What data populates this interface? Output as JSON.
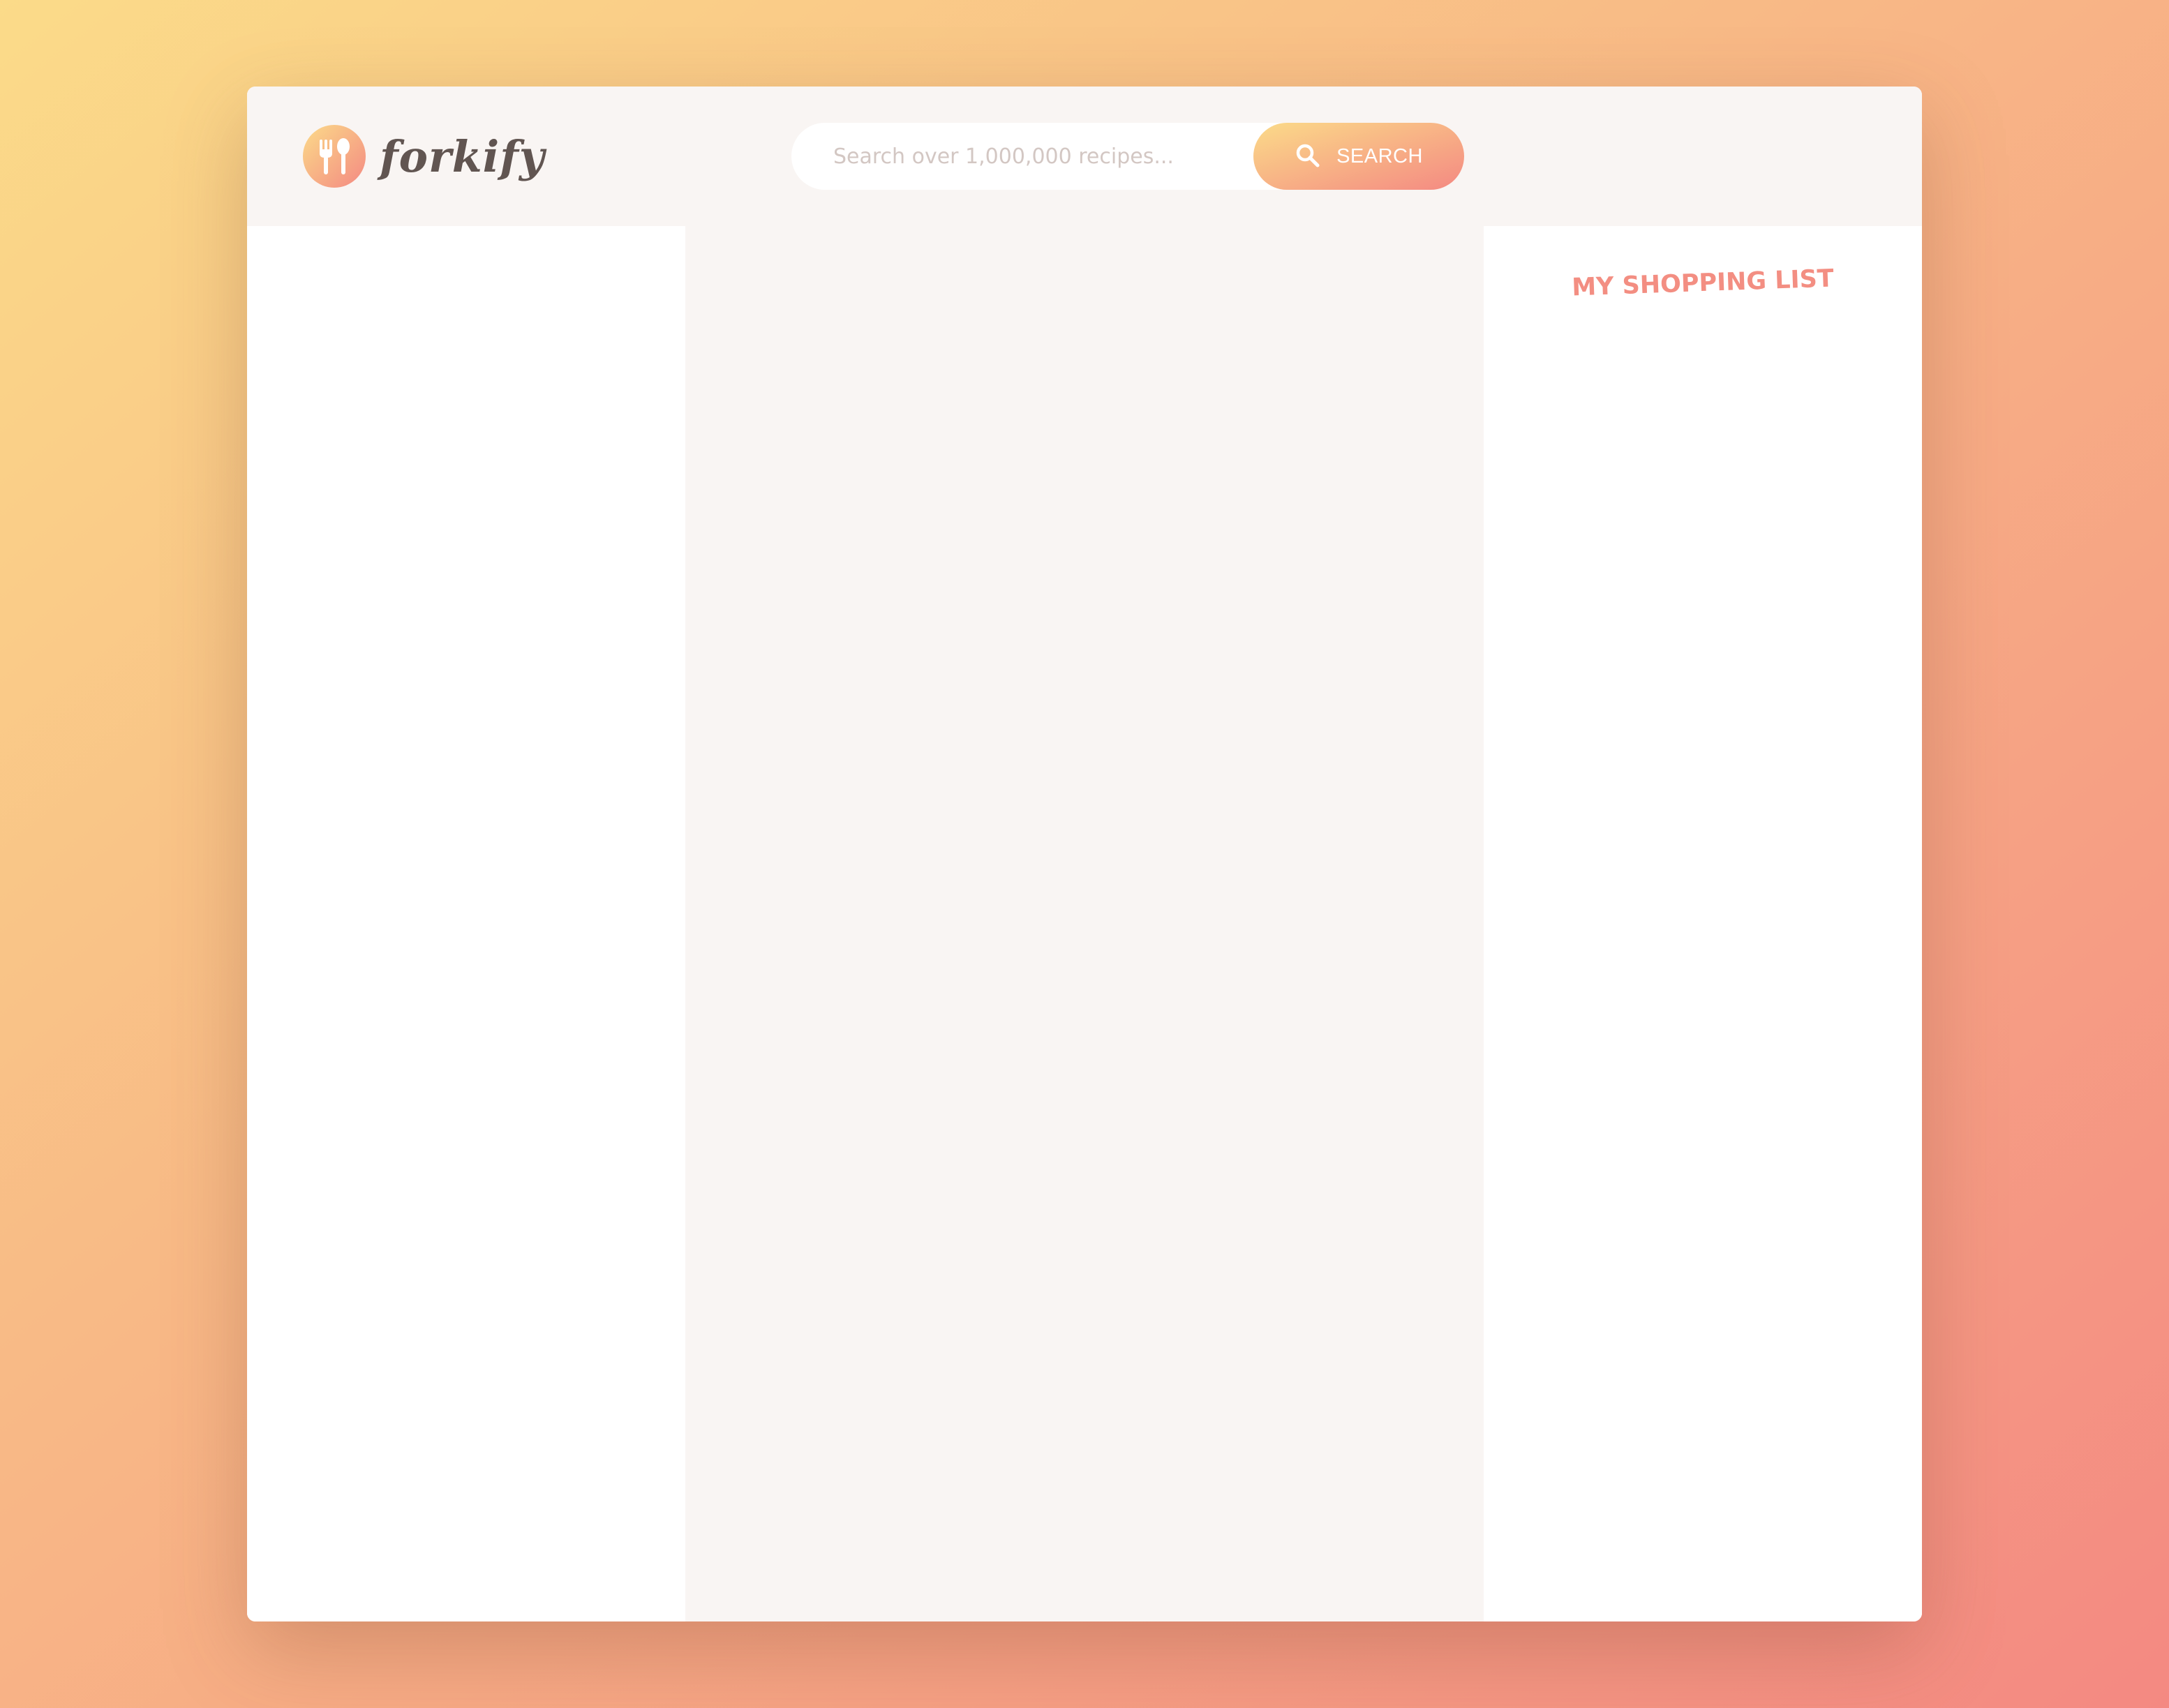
{
  "app": {
    "logo_text": "forkify"
  },
  "search": {
    "placeholder": "Search over 1,000,000 recipes...",
    "value": "",
    "button_label": "SEARCH"
  },
  "shopping": {
    "title": "MY SHOPPING LIST"
  },
  "icons": {
    "logo": "fork-spoon-icon",
    "search": "search-icon"
  },
  "colors": {
    "gradient_start": "#fbdb89",
    "gradient_end": "#f48982",
    "header_bg": "#f9f5f3",
    "accent": "#f38e82",
    "logo_text": "#615551"
  }
}
